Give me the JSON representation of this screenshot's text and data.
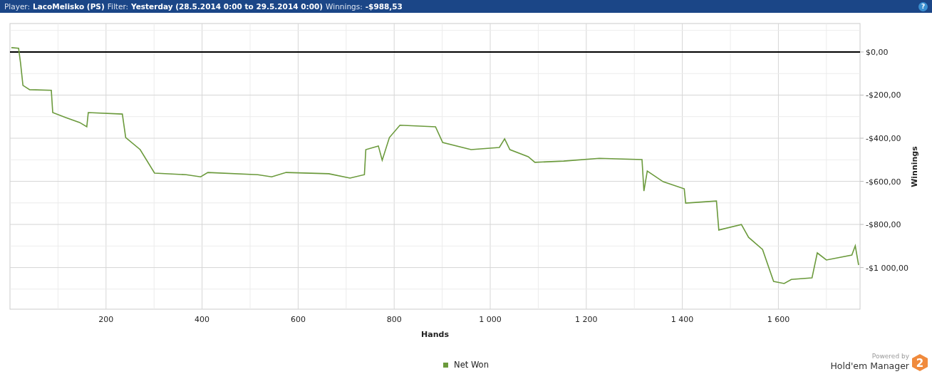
{
  "header": {
    "help": "?",
    "fields": [
      {
        "label": "Player:",
        "value": "LacoMelisko (PS)"
      },
      {
        "label": "Filter:",
        "value": "Yesterday (28.5.2014 0:00 to 29.5.2014 0:00)"
      },
      {
        "label": "Winnings:",
        "value": "-$988,53"
      }
    ]
  },
  "chart": {
    "chart_data": {
      "type": "line",
      "grid": true,
      "xlabel": "Hands",
      "ylabel": "Winnings",
      "xlim": [
        0,
        1770
      ],
      "ylim": [
        -1193,
        132
      ],
      "xticks": [
        {
          "value": 200,
          "label": "200"
        },
        {
          "value": 400,
          "label": "400"
        },
        {
          "value": 600,
          "label": "600"
        },
        {
          "value": 800,
          "label": "800"
        },
        {
          "value": 1000,
          "label": "1 000"
        },
        {
          "value": 1200,
          "label": "1 200"
        },
        {
          "value": 1400,
          "label": "1 400"
        },
        {
          "value": 1600,
          "label": "1 600"
        }
      ],
      "yticks": [
        {
          "value": 0,
          "label": "$0,00"
        },
        {
          "value": -200,
          "label": "-$200,00"
        },
        {
          "value": -400,
          "label": "-$400,00"
        },
        {
          "value": -600,
          "label": "-$600,00"
        },
        {
          "value": -800,
          "label": "-$800,00"
        },
        {
          "value": -1000,
          "label": "-$1 000,00"
        }
      ],
      "x": [
        3,
        18,
        22,
        27,
        41,
        86,
        89,
        116,
        145,
        160,
        163,
        234,
        241,
        271,
        301,
        367,
        397,
        412,
        516,
        545,
        575,
        664,
        708,
        738,
        741,
        767,
        775,
        790,
        812,
        886,
        901,
        960,
        1019,
        1030,
        1041,
        1079,
        1093,
        1153,
        1227,
        1316,
        1320,
        1327,
        1360,
        1404,
        1407,
        1471,
        1476,
        1523,
        1538,
        1567,
        1590,
        1612,
        1627,
        1670,
        1681,
        1700,
        1753,
        1760,
        1767
      ],
      "series": [
        {
          "name": "Net Won",
          "color": "#6b9a3c",
          "values": [
            20,
            17,
            -50,
            -155,
            -175,
            -178,
            -281,
            -304,
            -327,
            -347,
            -281,
            -288,
            -397,
            -453,
            -562,
            -569,
            -579,
            -559,
            -569,
            -579,
            -559,
            -565,
            -585,
            -569,
            -453,
            -436,
            -502,
            -397,
            -340,
            -347,
            -420,
            -453,
            -443,
            -403,
            -453,
            -486,
            -512,
            -506,
            -493,
            -499,
            -645,
            -552,
            -602,
            -635,
            -701,
            -691,
            -826,
            -800,
            -860,
            -916,
            -1064,
            -1074,
            -1055,
            -1048,
            -932,
            -965,
            -942,
            -899,
            -988
          ]
        }
      ]
    }
  },
  "branding": {
    "tagline": "Powered by",
    "name": "Hold'em Manager",
    "badge": "2"
  }
}
